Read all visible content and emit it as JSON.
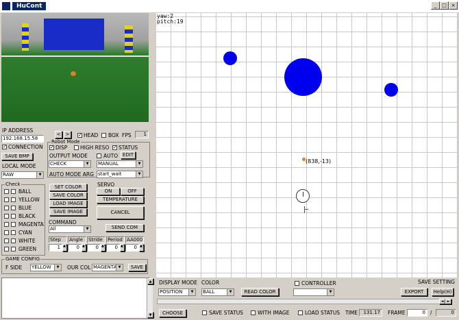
{
  "window": {
    "title": "HuCont",
    "min": "_",
    "max": "□",
    "close": "×"
  },
  "readout": {
    "yaw": "yaw:2",
    "pitch": "pitch:19"
  },
  "field": {
    "marker_label": "(838,-13)",
    "colors": {
      "blob": "#0000ee",
      "marker": "#e08020"
    }
  },
  "left": {
    "ip_label": "IP ADDRESS",
    "ip_value": "192.168.15.58",
    "nav_prev": "<",
    "nav_next": ">",
    "head_label": "HEAD",
    "box_label": "BOX",
    "fps_label": "FPS",
    "fps_value": "1",
    "connection_label": "CONNECTION",
    "robot_mode": {
      "title": "Robot Mode",
      "disp": "DISP",
      "high_reso": "HIGH RESO",
      "status": "STATUS"
    },
    "save_bmp": "SAVE BMP",
    "output_mode": {
      "label": "OUTPUT MODE",
      "value": "CHECK"
    },
    "auto_label": "AUTO",
    "edit_label": "EDIT",
    "manual_value": "MANUAL",
    "local_mode": {
      "label": "LOCAL MODE",
      "value": "RAW"
    },
    "auto_mode_arg": {
      "label": "AUTO MODE ARG",
      "value": "start_wait"
    },
    "check": {
      "title": "Check",
      "items": [
        "BALL",
        "YELLOW",
        "BLUE",
        "BLACK",
        "MAGENTA",
        "CYAN",
        "WHITE",
        "GREEN"
      ]
    },
    "buttons": {
      "set_color": "SET COLOR",
      "save_color": "SAVE COLOR",
      "load_image": "LOAD IMAGE",
      "save_image": "SAVE IMAGE",
      "on": "ON",
      "off": "OFF",
      "temperature": "TEMPERATURE",
      "cancel": "CANCEL",
      "send_com": "SEND COM",
      "save": "SAVE"
    },
    "servo_title": "SERVO",
    "command": {
      "title": "COMMAND",
      "value": "All"
    },
    "params": {
      "headers": [
        "Step",
        "Angle",
        "Stride",
        "Period",
        "AA000"
      ],
      "values": [
        "1",
        "0",
        "0",
        "0",
        "0"
      ]
    },
    "game_config": {
      "title": "GAME CONFIG",
      "f_side_label": "F SIDE",
      "f_side_value": "YELLOW",
      "our_col_label": "OUR COL",
      "our_col_value": "MAGENTA"
    }
  },
  "bottom": {
    "display_mode": {
      "label": "DISPLAY MODE",
      "value": "POSITION"
    },
    "color": {
      "label": "COLOR",
      "value": "BALL"
    },
    "read_color": "READ COLOR",
    "controller_label": "CONTROLLER",
    "save_setting": "SAVE SETTING",
    "export": "EXPORT",
    "help": "Help(H)",
    "choose": "CHOOSE",
    "save_status": "SAVE STATUS",
    "with_image": "WITH IMAGE",
    "load_status": "LOAD STATUS",
    "time_label": "TIME",
    "time_value": "131.17",
    "frame_label": "FRAME",
    "frame_value": "0",
    "frame_sep": "/",
    "frame_total": "0",
    "scroll_left": "◄",
    "scroll_right": "►",
    "up": "▲",
    "down": "▼"
  }
}
